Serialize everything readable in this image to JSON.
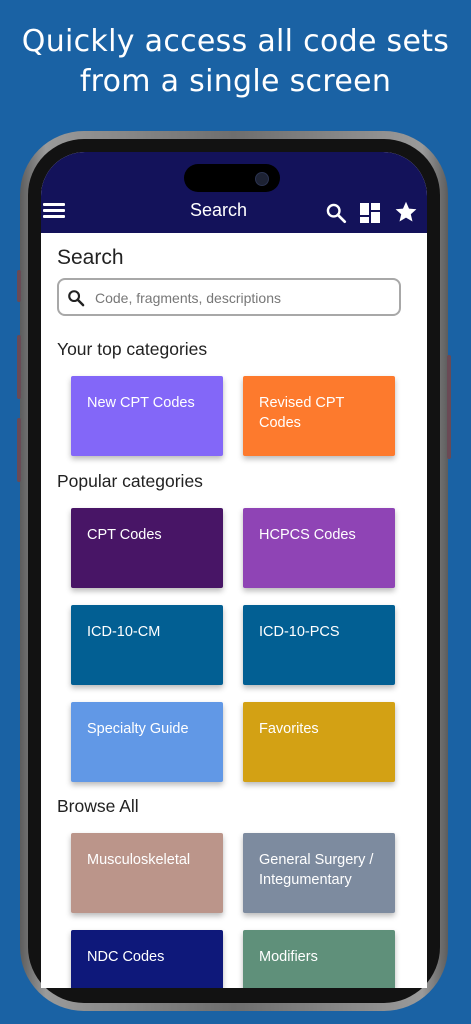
{
  "promo": {
    "line1": "Quickly access all code sets",
    "line2": "from a single screen"
  },
  "appbar": {
    "title": "Search",
    "menu_icon": "hamburger-menu-icon",
    "search_icon": "search-icon",
    "dashboard_icon": "dashboard-grid-icon",
    "favorites_icon": "star-icon"
  },
  "search": {
    "heading": "Search",
    "placeholder": "Code, fragments, descriptions",
    "value": ""
  },
  "top_categories": {
    "heading": "Your top categories",
    "items": [
      {
        "label": "New CPT Codes",
        "color": "#8367f8"
      },
      {
        "label": "Revised CPT Codes",
        "color": "#fd7a2d"
      }
    ]
  },
  "popular_categories": {
    "heading": "Popular categories",
    "items": [
      {
        "label": "CPT Codes",
        "color": "#481566"
      },
      {
        "label": "HCPCS Codes",
        "color": "#8f44b5"
      },
      {
        "label": "ICD-10-CM",
        "color": "#025f93"
      },
      {
        "label": "ICD-10-PCS",
        "color": "#025f93"
      },
      {
        "label": "Specialty Guide",
        "color": "#6198e6"
      },
      {
        "label": "Favorites",
        "color": "#d3a114"
      }
    ]
  },
  "browse_all": {
    "heading": "Browse All",
    "items": [
      {
        "label": "Musculoskeletal",
        "color": "#bb958a"
      },
      {
        "label": "General Surgery / Integumentary",
        "color": "#7d8b9f"
      },
      {
        "label": "NDC Codes",
        "color": "#0e187a"
      },
      {
        "label": "Modifiers",
        "color": "#5f907a"
      }
    ]
  }
}
